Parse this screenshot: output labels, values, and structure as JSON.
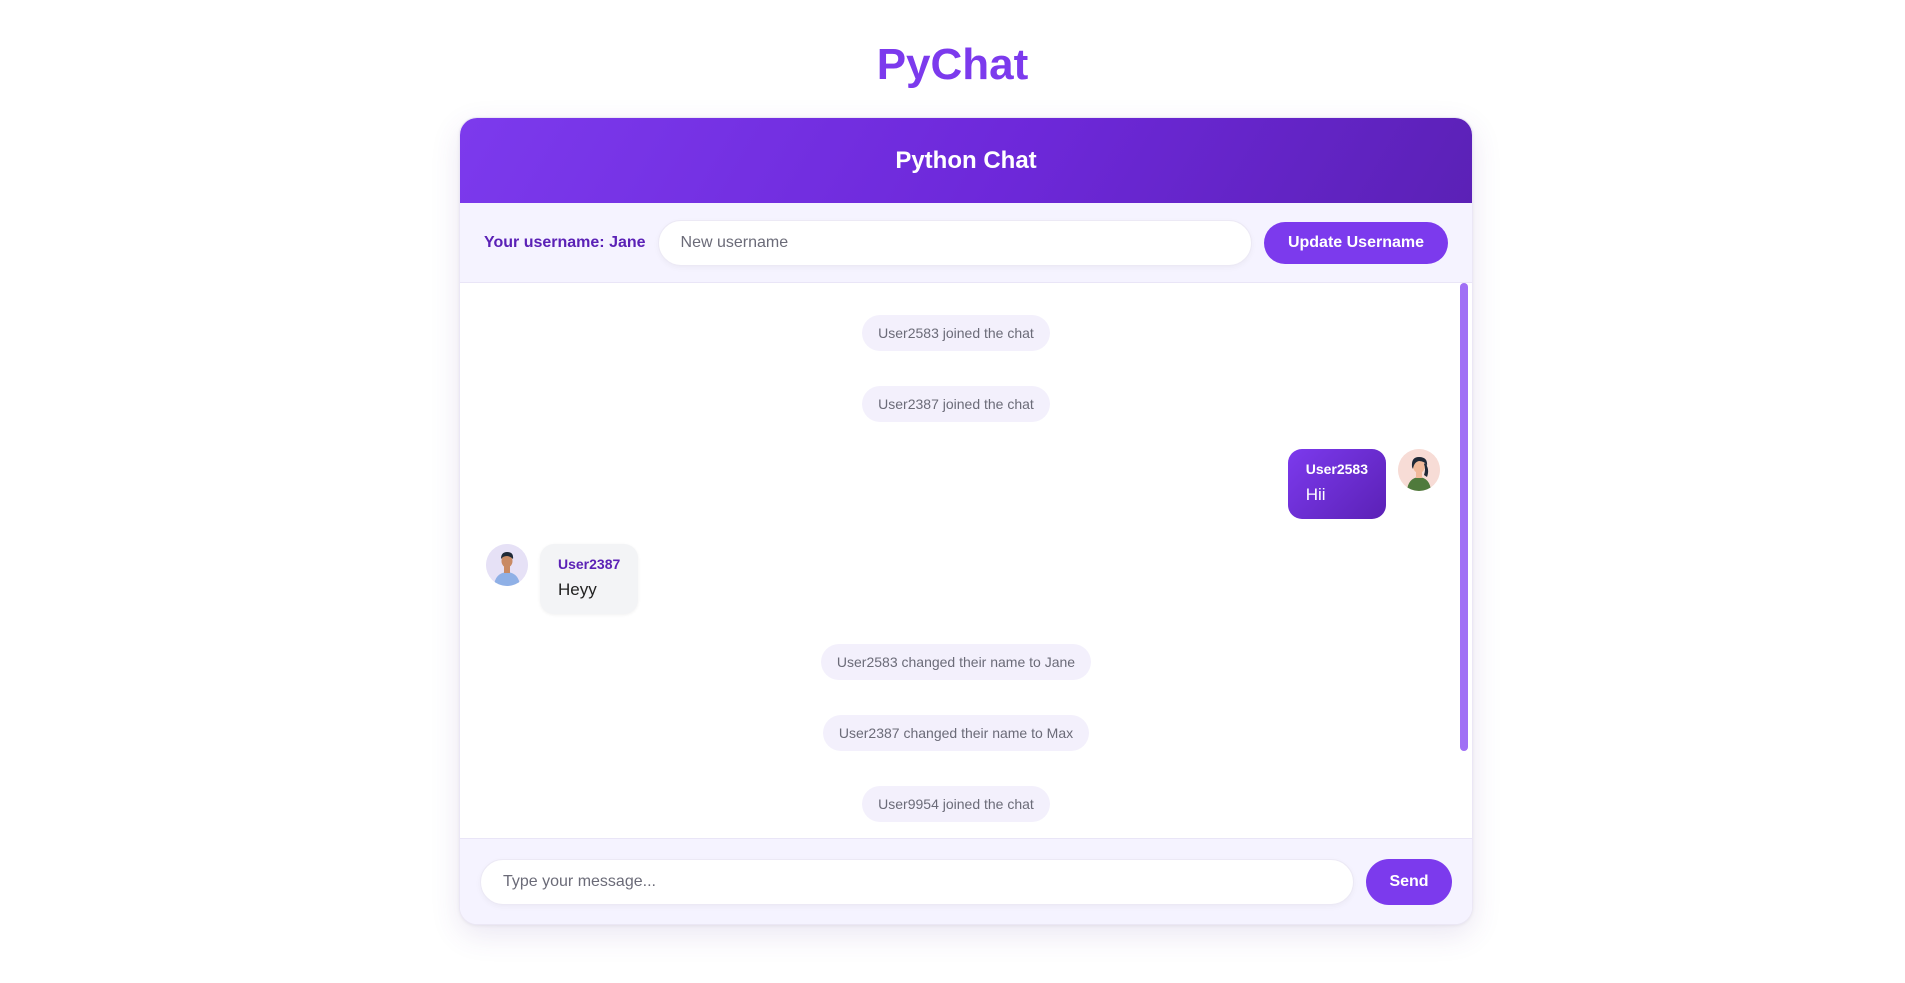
{
  "app_title": "PyChat",
  "header": {
    "title": "Python Chat"
  },
  "username_bar": {
    "label": "Your username: Jane",
    "input_placeholder": "New username",
    "input_value": "",
    "update_button": "Update Username"
  },
  "messages": [
    {
      "type": "system",
      "text": "User2583 joined the chat"
    },
    {
      "type": "system",
      "text": "User2387 joined the chat"
    },
    {
      "type": "outgoing",
      "user": "User2583",
      "text": "Hii",
      "avatar": "woman-avatar-icon"
    },
    {
      "type": "incoming",
      "user": "User2387",
      "text": "Heyy",
      "avatar": "man-avatar-icon"
    },
    {
      "type": "system",
      "text": "User2583 changed their name to Jane"
    },
    {
      "type": "system",
      "text": "User2387 changed their name to Max"
    },
    {
      "type": "system",
      "text": "User9954 joined the chat"
    }
  ],
  "composer": {
    "placeholder": "Type your message...",
    "value": "",
    "send_label": "Send"
  },
  "colors": {
    "accent": "#7c3aed",
    "accent_dark": "#5b21b6",
    "panel_bg": "#f5f3ff",
    "system_pill_bg": "#f3f0fc"
  }
}
